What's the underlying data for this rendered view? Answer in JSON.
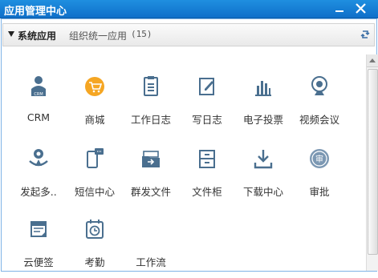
{
  "window": {
    "title": "应用管理中心"
  },
  "section": {
    "title": "系统应用",
    "subtitle": "组织统一应用",
    "count": "(15)"
  },
  "colors": {
    "titlebar": "#1479d6",
    "icon": "#4a6f8f",
    "shop": "#f5a623"
  },
  "apps": [
    {
      "label": "CRM",
      "icon": "crm-icon"
    },
    {
      "label": "商城",
      "icon": "shop-icon"
    },
    {
      "label": "工作日志",
      "icon": "work-log-icon"
    },
    {
      "label": "写日志",
      "icon": "write-log-icon"
    },
    {
      "label": "电子投票",
      "icon": "vote-icon"
    },
    {
      "label": "视频会议",
      "icon": "video-conference-icon"
    },
    {
      "label": "发起多..",
      "icon": "multi-call-icon"
    },
    {
      "label": "短信中心",
      "icon": "sms-center-icon"
    },
    {
      "label": "群发文件",
      "icon": "group-file-icon"
    },
    {
      "label": "文件柜",
      "icon": "file-cabinet-icon"
    },
    {
      "label": "下载中心",
      "icon": "download-center-icon"
    },
    {
      "label": "审批",
      "icon": "approval-icon"
    },
    {
      "label": "云便签",
      "icon": "cloud-note-icon"
    },
    {
      "label": "考勤",
      "icon": "attendance-icon"
    },
    {
      "label": "工作流",
      "icon": "workflow-icon"
    }
  ]
}
